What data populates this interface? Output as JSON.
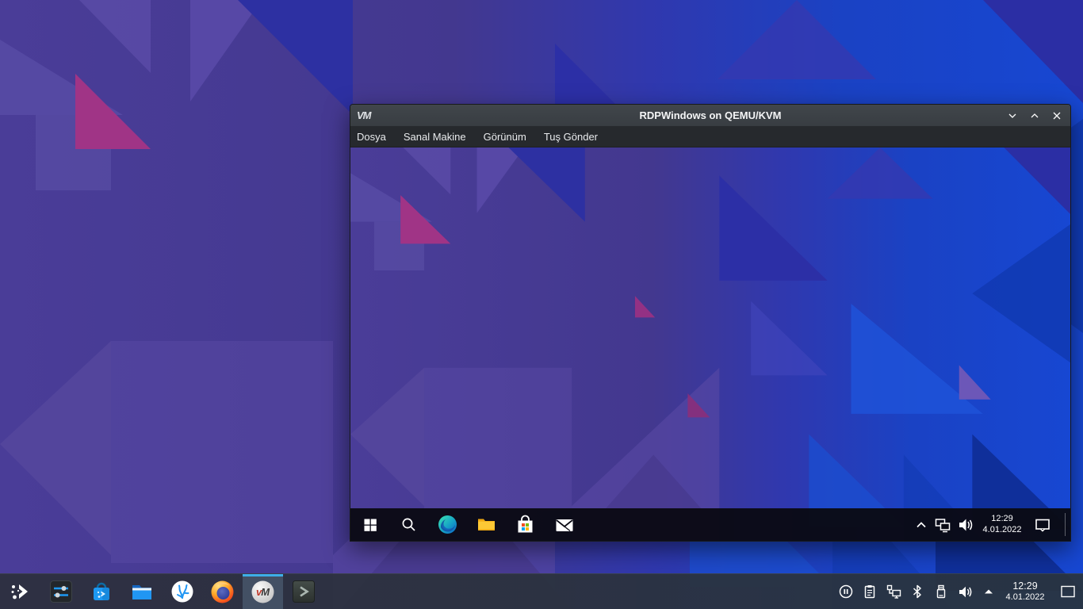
{
  "host": {
    "wallpaper_colors": {
      "purple_base": "#473b92",
      "purple_light": "#5b4ca8",
      "magenta": "#9c3183",
      "navy": "#2c2fa0",
      "blue_base": "#1843c6",
      "blue_bright": "#1f52d8"
    },
    "panel": {
      "apps": [
        "app-launcher",
        "system-settings",
        "discover-software-center",
        "file-manager",
        "coral-app",
        "firefox",
        "virt-manager",
        "terminal"
      ],
      "active_app": "virt-manager",
      "accent_color": "#3daee9",
      "tray_icons": [
        "media-pause",
        "clipboard",
        "wired-network",
        "bluetooth",
        "removable-device",
        "volume",
        "expand-tray"
      ],
      "clock": {
        "time": "12:29",
        "date": "4.01.2022"
      },
      "show_desktop": "show-desktop"
    }
  },
  "vm_window": {
    "title": "RDPWindows on QEMU/KVM",
    "logo": "VM",
    "menu": [
      "Dosya",
      "Sanal Makine",
      "Görünüm",
      "Tuş Gönder"
    ],
    "controls": [
      "minimize",
      "maximize",
      "close"
    ]
  },
  "guest": {
    "taskbar": {
      "icons": [
        "start",
        "search",
        "edge",
        "file-explorer",
        "microsoft-store",
        "mail"
      ],
      "tray_icons": [
        "hidden-icons",
        "ethernet",
        "volume"
      ],
      "clock": {
        "time": "12:29",
        "date": "4.01.2022"
      },
      "action_center": "action-center"
    }
  }
}
